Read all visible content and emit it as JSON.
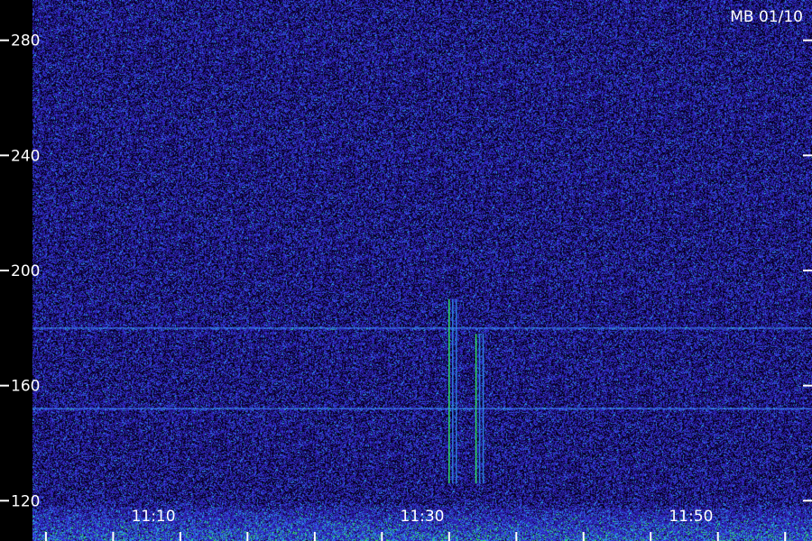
{
  "chart_data": {
    "type": "heatmap",
    "title": "MB 01/10",
    "xlabel": "",
    "ylabel": "",
    "y_ticks": [
      120,
      160,
      200,
      240,
      280
    ],
    "y_tick_labels": [
      "120",
      "160",
      "200",
      "240",
      "280"
    ],
    "x_ticks": [
      "11:10",
      "11:30",
      "11:50"
    ],
    "x_range": [
      "11:01",
      "11:59"
    ],
    "ylim": [
      106,
      294
    ],
    "colormap": [
      "#000000",
      "#1a0a6e",
      "#2a22c8",
      "#3a5cf0",
      "#22b0e8",
      "#28e060"
    ],
    "background_color": "#2b1a8c",
    "events": [
      {
        "type": "vertical-burst",
        "time": "11:32",
        "freq_range": [
          126,
          190
        ]
      },
      {
        "type": "vertical-burst",
        "time": "11:34",
        "freq_range": [
          126,
          178
        ]
      },
      {
        "type": "horizontal-line",
        "freq": 152
      },
      {
        "type": "horizontal-line",
        "freq": 180
      }
    ],
    "grid": false
  }
}
